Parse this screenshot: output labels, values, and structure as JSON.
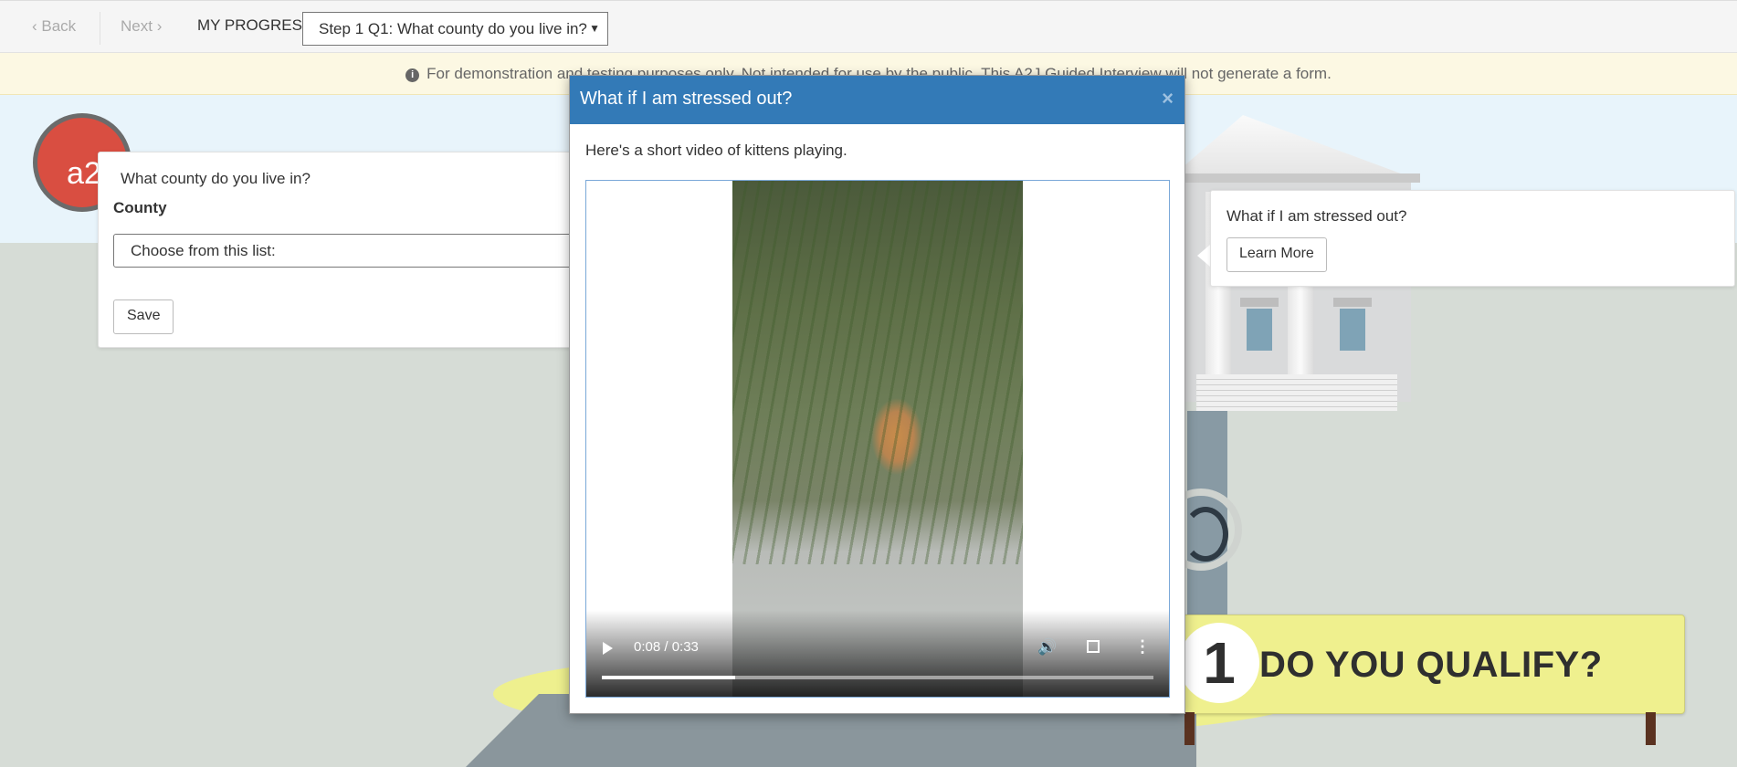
{
  "nav": {
    "back_label": "Back",
    "next_label": "Next",
    "progress_label": "MY PROGRESS:",
    "progress_selected": "Step 1 Q1: What county do you live in?"
  },
  "notice": {
    "text": "For demonstration and testing purposes only. Not intended for use by the public. This A2J Guided Interview will not generate a form."
  },
  "avatar": {
    "text": "a2j"
  },
  "question_card": {
    "question": "What county do you live in?",
    "field_label": "County",
    "select_placeholder": "Choose from this list:",
    "save_label": "Save"
  },
  "learn_more_card": {
    "question": "What if I am stressed out?",
    "button_label": "Learn More"
  },
  "modal": {
    "title": "What if I am stressed out?",
    "close_glyph": "×",
    "body_text": "Here's a short video of kittens playing.",
    "video": {
      "time": "0:08 / 0:33",
      "progress_fraction": 0.242
    }
  },
  "scene": {
    "step_number": "1",
    "step_title": "DO YOU QUALIFY?"
  },
  "colors": {
    "modal_header": "#337ab7",
    "notice_bg": "#fcf8e3",
    "step_banner": "#eff08e",
    "avatar": "#d94e41"
  }
}
